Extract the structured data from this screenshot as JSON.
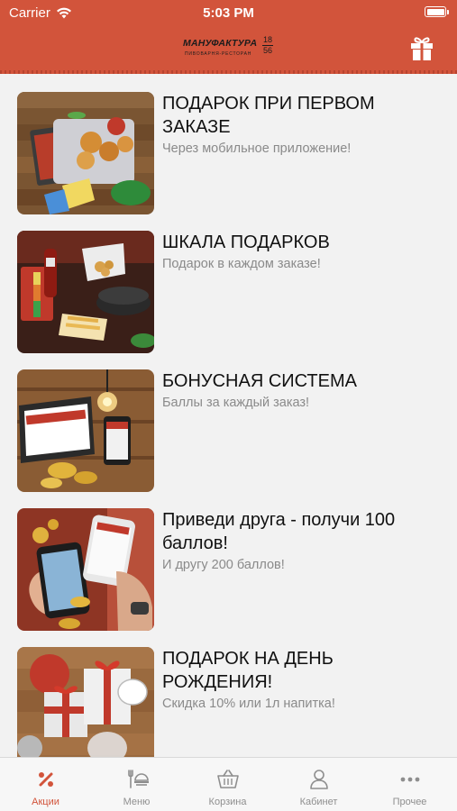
{
  "status_bar": {
    "carrier": "Carrier",
    "time": "5:03 PM"
  },
  "header": {
    "logo_text": "МАНУФАКТУРА",
    "logo_subtitle": "ПИВОВАРНЯ-РЕСТОРАН",
    "logo_year_top": "18",
    "logo_year_bottom": "56",
    "action_icon": "gift-icon"
  },
  "colors": {
    "accent": "#d2543b",
    "tab_inactive": "#8e8e8e"
  },
  "promos": [
    {
      "title": "ПОДАРОК ПРИ ПЕРВОМ ЗАКАЗЕ",
      "subtitle": "Через мобильное приложение!"
    },
    {
      "title": "ШКАЛА ПОДАРКОВ",
      "subtitle": "Подарок в каждом заказе!"
    },
    {
      "title": "БОНУСНАЯ СИСТЕМА",
      "subtitle": "Баллы за каждый заказ!"
    },
    {
      "title": "Приведи друга - получи 100 баллов!",
      "subtitle": "И другу 200 баллов!"
    },
    {
      "title": "ПОДАРОК НА ДЕНЬ РОЖДЕНИЯ!",
      "subtitle": "Скидка 10% или 1л напитка!"
    }
  ],
  "tabs": [
    {
      "label": "Акции",
      "icon": "percent-icon",
      "active": true
    },
    {
      "label": "Меню",
      "icon": "menu-icon",
      "active": false
    },
    {
      "label": "Корзина",
      "icon": "basket-icon",
      "active": false
    },
    {
      "label": "Кабинет",
      "icon": "user-icon",
      "active": false
    },
    {
      "label": "Прочее",
      "icon": "more-icon",
      "active": false
    }
  ]
}
